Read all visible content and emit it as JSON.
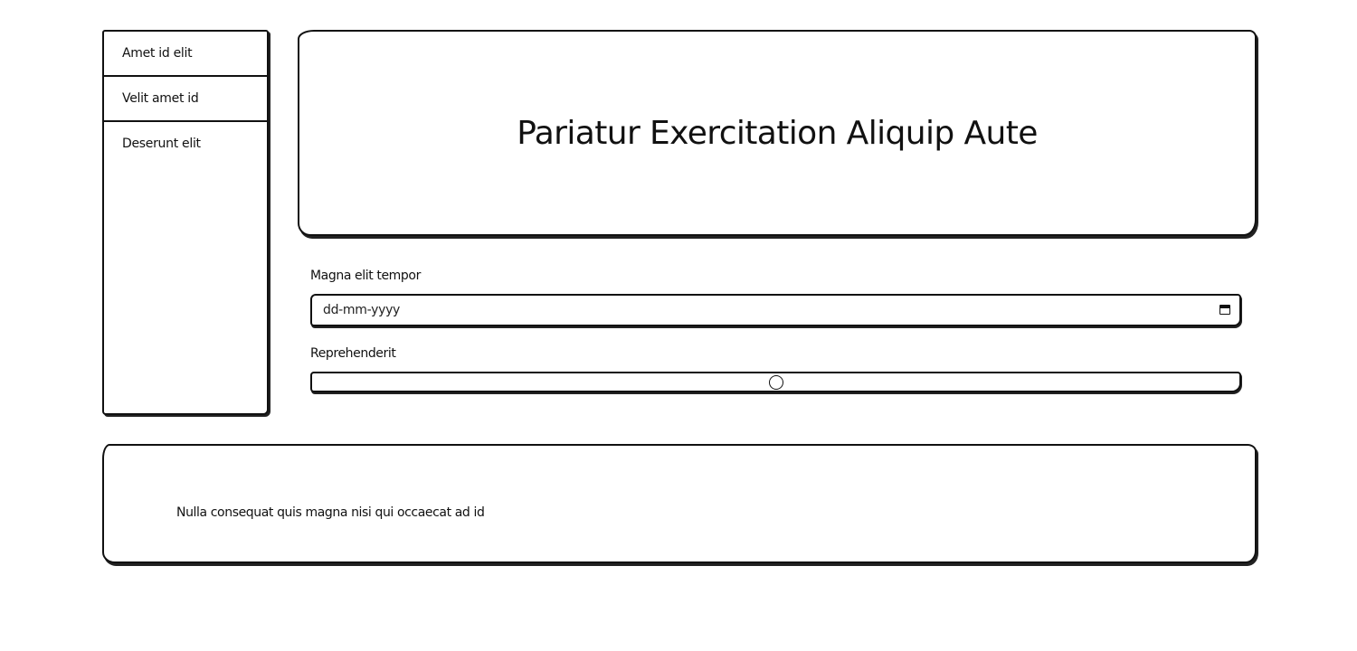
{
  "sidebar": {
    "items": [
      {
        "label": "Amet id elit"
      },
      {
        "label": "Velit amet id"
      },
      {
        "label": "Deserunt elit"
      }
    ]
  },
  "hero": {
    "title": "Pariatur Exercitation Aliquip Aute"
  },
  "form": {
    "date_field": {
      "label": "Magna elit tempor",
      "placeholder": "dd-mm-yyyy",
      "icon": "calendar-icon"
    },
    "range_field": {
      "label": "Reprehenderit",
      "value_fraction": 0.5
    }
  },
  "footer": {
    "text": "Nulla consequat quis magna nisi qui occaecat ad id"
  }
}
